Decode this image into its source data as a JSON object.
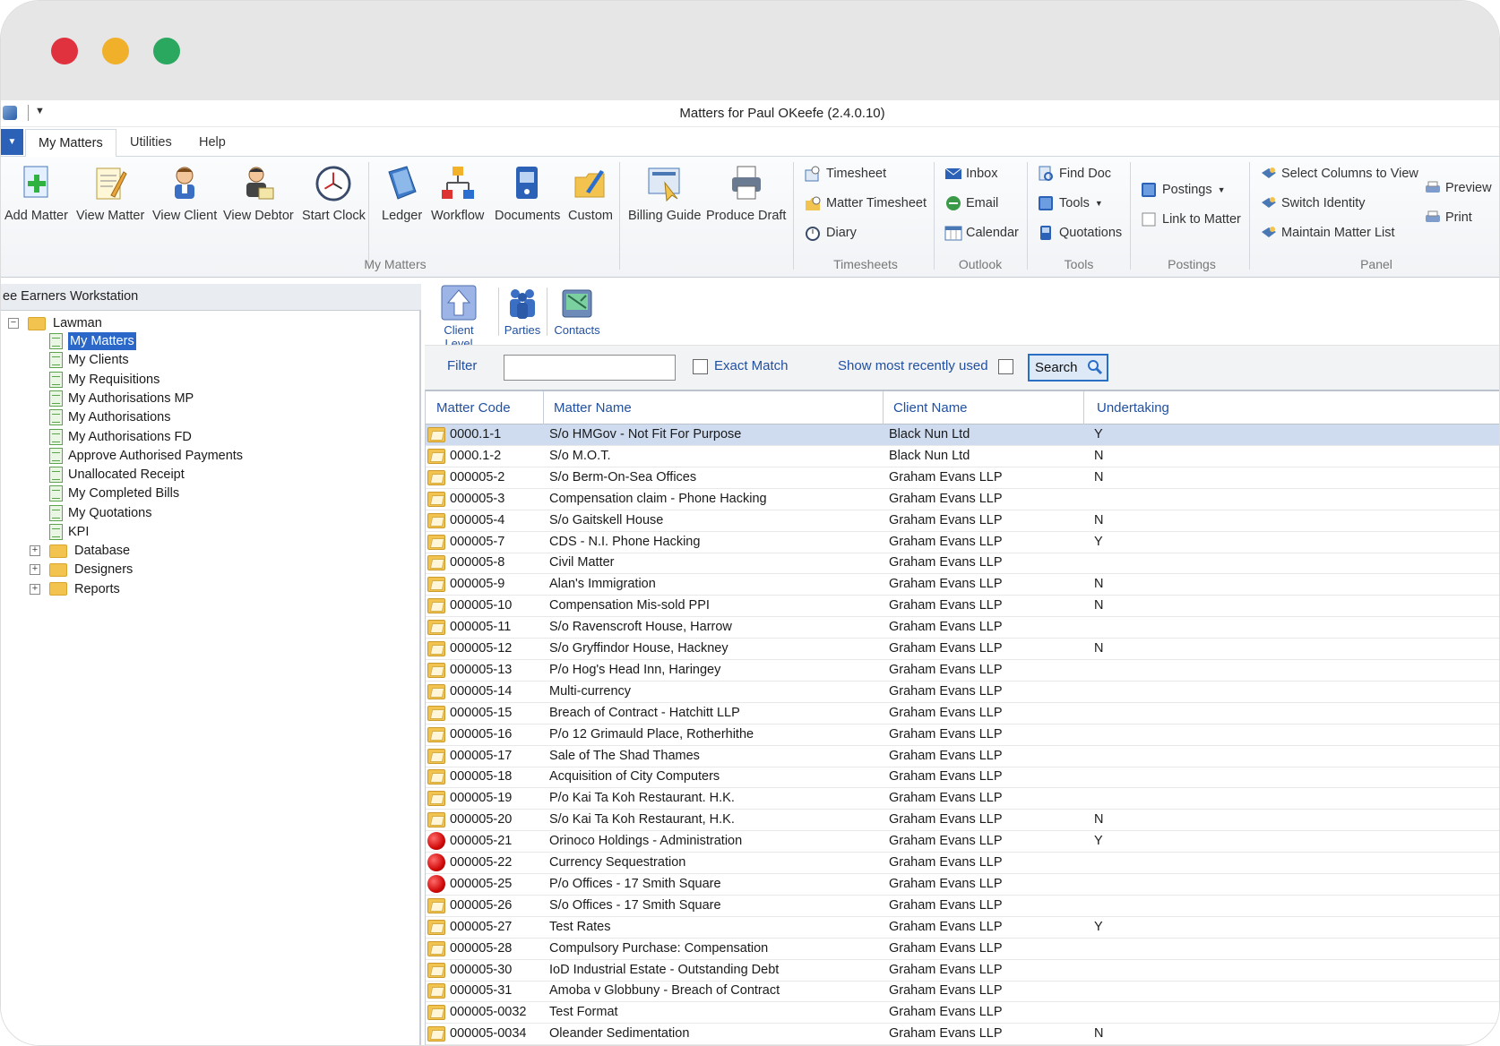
{
  "window": {
    "title": "Matters for Paul OKeefe (2.4.0.10)"
  },
  "menu_tabs": [
    {
      "label": "My Matters",
      "active": true
    },
    {
      "label": "Utilities",
      "active": false
    },
    {
      "label": "Help",
      "active": false
    }
  ],
  "ribbon": {
    "my_matters": {
      "group_label": "My Matters",
      "buttons": [
        {
          "label": "Add Matter",
          "icon": "add-matter-icon"
        },
        {
          "label": "View Matter",
          "icon": "view-matter-icon"
        },
        {
          "label": "View Client",
          "icon": "view-client-icon"
        },
        {
          "label": "View Debtor",
          "icon": "view-debtor-icon"
        },
        {
          "label": "Start Clock",
          "icon": "clock-icon"
        },
        {
          "label": "Ledger",
          "icon": "ledger-icon"
        },
        {
          "label": "Workflow",
          "icon": "workflow-icon"
        },
        {
          "label": "Documents",
          "icon": "documents-icon"
        },
        {
          "label": "Custom",
          "icon": "custom-icon"
        },
        {
          "label": "Billing Guide",
          "icon": "billing-guide-icon"
        },
        {
          "label": "Produce Draft",
          "icon": "produce-draft-icon"
        }
      ]
    },
    "timesheets": {
      "group_label": "Timesheets",
      "items": [
        "Timesheet",
        "Matter Timesheet",
        "Diary"
      ]
    },
    "outlook": {
      "group_label": "Outlook",
      "items": [
        "Inbox",
        "Email",
        "Calendar"
      ]
    },
    "tools": {
      "group_label": "Tools",
      "items": [
        "Find Doc",
        "Tools",
        "Quotations"
      ]
    },
    "postings": {
      "group_label": "Postings",
      "items": [
        "Postings",
        "Link to Matter"
      ]
    },
    "panel": {
      "group_label": "Panel",
      "items": [
        "Select Columns to View",
        "Switch Identity",
        "Maintain Matter List",
        "Preview",
        "Print"
      ]
    }
  },
  "left_panel": {
    "header": "ee Earners Workstation",
    "root": "Lawman",
    "items": [
      "My Matters",
      "My Clients",
      "My Requisitions",
      "My Authorisations MP",
      "My Authorisations",
      "My Authorisations FD",
      "Approve Authorised Payments",
      "Unallocated Receipt",
      "My Completed Bills",
      "My Quotations",
      "KPI"
    ],
    "selected": "My Matters",
    "folders": [
      "Database",
      "Designers",
      "Reports"
    ]
  },
  "right_toolbar": {
    "buttons": [
      "Client Level",
      "Parties",
      "Contacts"
    ]
  },
  "filter_bar": {
    "filter_label": "Filter",
    "filter_value": "",
    "exact_match_label": "Exact Match",
    "exact_match_checked": false,
    "recent_label": "Show most recently used",
    "recent_checked": false,
    "search_label": "Search"
  },
  "grid": {
    "columns": [
      "Matter Code",
      "Matter Name",
      "Client Name",
      "Undertaking"
    ],
    "rows": [
      {
        "code": "0000.1-1",
        "name": "S/o HMGov - Not Fit For Purpose",
        "client": "Black Nun Ltd",
        "undertaking": "Y",
        "icon": "folder-open-icon",
        "selected": true
      },
      {
        "code": "0000.1-2",
        "name": "S/o M.O.T.",
        "client": "Black Nun Ltd",
        "undertaking": "N",
        "icon": "folder-open-icon"
      },
      {
        "code": "000005-2",
        "name": "S/o Berm-On-Sea Offices",
        "client": "Graham Evans LLP",
        "undertaking": "N",
        "icon": "folder-open-icon"
      },
      {
        "code": "000005-3",
        "name": "Compensation claim - Phone Hacking",
        "client": "Graham Evans LLP",
        "undertaking": "",
        "icon": "folder-open-icon"
      },
      {
        "code": "000005-4",
        "name": "S/o Gaitskell House",
        "client": "Graham Evans LLP",
        "undertaking": "N",
        "icon": "folder-open-icon"
      },
      {
        "code": "000005-7",
        "name": "CDS - N.I. Phone Hacking",
        "client": "Graham Evans LLP",
        "undertaking": "Y",
        "icon": "folder-open-icon"
      },
      {
        "code": "000005-8",
        "name": "Civil Matter",
        "client": "Graham Evans LLP",
        "undertaking": "",
        "icon": "folder-open-icon"
      },
      {
        "code": "000005-9",
        "name": "Alan's Immigration",
        "client": "Graham Evans LLP",
        "undertaking": "N",
        "icon": "folder-open-icon"
      },
      {
        "code": "000005-10",
        "name": "Compensation Mis-sold PPI",
        "client": "Graham Evans LLP",
        "undertaking": "N",
        "icon": "folder-open-icon"
      },
      {
        "code": "000005-11",
        "name": "S/o Ravenscroft House, Harrow",
        "client": "Graham Evans LLP",
        "undertaking": "",
        "icon": "folder-open-icon"
      },
      {
        "code": "000005-12",
        "name": "S/o Gryffindor House, Hackney",
        "client": "Graham Evans LLP",
        "undertaking": "N",
        "icon": "folder-open-icon"
      },
      {
        "code": "000005-13",
        "name": "P/o Hog's Head  Inn, Haringey",
        "client": "Graham Evans LLP",
        "undertaking": "",
        "icon": "folder-open-icon"
      },
      {
        "code": "000005-14",
        "name": "Multi-currency",
        "client": "Graham Evans LLP",
        "undertaking": "",
        "icon": "folder-open-icon"
      },
      {
        "code": "000005-15",
        "name": "Breach of Contract - Hatchitt LLP",
        "client": "Graham Evans LLP",
        "undertaking": "",
        "icon": "folder-open-icon"
      },
      {
        "code": "000005-16",
        "name": "P/o 12 Grimauld Place, Rotherhithe",
        "client": "Graham Evans LLP",
        "undertaking": "",
        "icon": "folder-open-icon"
      },
      {
        "code": "000005-17",
        "name": "Sale of The Shad Thames",
        "client": "Graham Evans LLP",
        "undertaking": "",
        "icon": "folder-open-icon"
      },
      {
        "code": "000005-18",
        "name": "Acquisition of City Computers",
        "client": "Graham Evans LLP",
        "undertaking": "",
        "icon": "folder-open-icon"
      },
      {
        "code": "000005-19",
        "name": "P/o Kai Ta Koh Restaurant. H.K.",
        "client": "Graham Evans LLP",
        "undertaking": "",
        "icon": "folder-open-icon"
      },
      {
        "code": "000005-20",
        "name": "S/o Kai Ta Koh Restaurant, H.K.",
        "client": "Graham Evans LLP",
        "undertaking": "N",
        "icon": "folder-open-icon"
      },
      {
        "code": "000005-21",
        "name": "Orinoco Holdings - Administration",
        "client": "Graham Evans LLP",
        "undertaking": "Y",
        "icon": "red-dot-icon"
      },
      {
        "code": "000005-22",
        "name": "Currency Sequestration",
        "client": "Graham Evans LLP",
        "undertaking": "",
        "icon": "red-dot-icon"
      },
      {
        "code": "000005-25",
        "name": "P/o Offices - 17 Smith Square",
        "client": "Graham Evans LLP",
        "undertaking": "",
        "icon": "red-dot-icon"
      },
      {
        "code": "000005-26",
        "name": "S/o Offices - 17 Smith Square",
        "client": "Graham Evans LLP",
        "undertaking": "",
        "icon": "folder-open-icon"
      },
      {
        "code": "000005-27",
        "name": "Test Rates",
        "client": "Graham Evans LLP",
        "undertaking": "Y",
        "icon": "folder-open-icon"
      },
      {
        "code": "000005-28",
        "name": "Compulsory Purchase: Compensation",
        "client": "Graham Evans LLP",
        "undertaking": "",
        "icon": "folder-open-icon"
      },
      {
        "code": "000005-30",
        "name": "IoD Industrial Estate - Outstanding Debt",
        "client": "Graham Evans LLP",
        "undertaking": "",
        "icon": "folder-open-icon"
      },
      {
        "code": "000005-31",
        "name": "Amoba v Globbuny - Breach of Contract",
        "client": "Graham Evans LLP",
        "undertaking": "",
        "icon": "folder-open-icon"
      },
      {
        "code": "000005-0032",
        "name": "Test Format",
        "client": "Graham Evans LLP",
        "undertaking": "",
        "icon": "folder-open-icon"
      },
      {
        "code": "000005-0034",
        "name": "Oleander Sedimentation",
        "client": "Graham Evans LLP",
        "undertaking": "N",
        "icon": "folder-open-icon"
      }
    ]
  },
  "colors": {
    "accent": "#2150a0",
    "selection": "#2a67c9",
    "row_selected": "#cfdcf0"
  }
}
